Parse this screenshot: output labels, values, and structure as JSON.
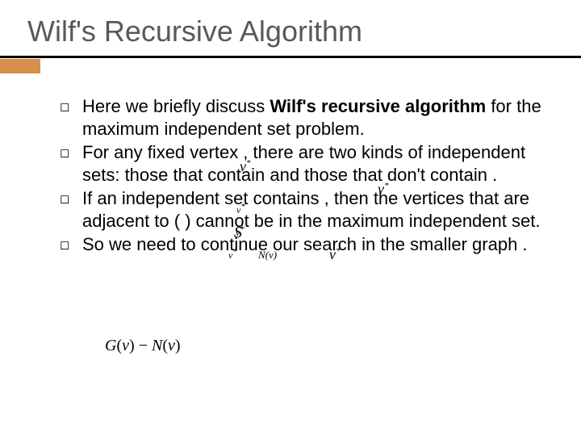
{
  "title": "Wilf's Recursive Algorithm",
  "bullet": "◻",
  "items": [
    {
      "a": "Here we briefly discuss ",
      "b": "Wilf's recursive algorithm",
      "c": " for the maximum independent set problem."
    },
    {
      "a": "For any fixed vertex    , there are two kinds of independent sets: those that contain    and those that don't contain    ."
    },
    {
      "a": "If an independent set    contains    , then the vertices that are adjacent to    (       ) cannot be in the maximum independent set."
    },
    {
      "a": "So we need to continue our search in the smaller graph                       ."
    }
  ],
  "math": {
    "v": "v",
    "star": "*",
    "S": "S",
    "N": "N",
    "G": "G",
    "minus": "−"
  }
}
